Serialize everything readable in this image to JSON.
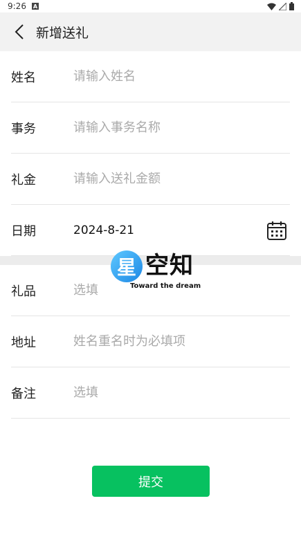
{
  "status_bar": {
    "time": "9:26"
  },
  "header": {
    "title": "新增送礼"
  },
  "form": {
    "name": {
      "label": "姓名",
      "placeholder": "请输入姓名"
    },
    "matter": {
      "label": "事务",
      "placeholder": "请输入事务名称"
    },
    "money": {
      "label": "礼金",
      "placeholder": "请输入送礼金额"
    },
    "date": {
      "label": "日期",
      "value": "2024-8-21"
    },
    "gift": {
      "label": "礼品",
      "placeholder": "选填"
    },
    "address": {
      "label": "地址",
      "placeholder": "姓名重名时为必填项"
    },
    "remark": {
      "label": "备注",
      "placeholder": "选填"
    }
  },
  "submit_label": "提交",
  "watermark": {
    "logo_char": "星",
    "name": "空知",
    "tagline": "Toward the dream"
  },
  "colors": {
    "accent": "#07c160",
    "header_bg": "#f2f2f2",
    "divider": "#e4e4e4"
  }
}
